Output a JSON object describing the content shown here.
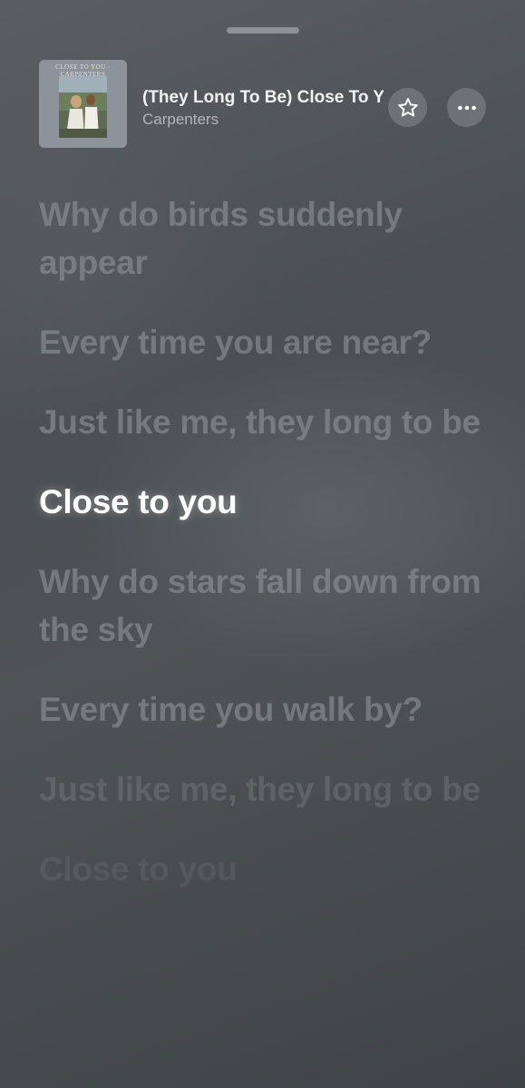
{
  "now_playing": {
    "title": "(They Long To Be) Close To You",
    "artist": "Carpenters",
    "artwork_text": "CLOSE TO YOU · CARPENTERS"
  },
  "controls": {
    "favorite_icon": "star-icon",
    "more_icon": "ellipsis-icon"
  },
  "lyrics": [
    "Why do birds suddenly appear",
    "Every time you are near?",
    "Just like me, they long to be",
    "Close to you",
    "Why do stars fall down from the sky",
    "Every time you walk by?",
    "Just like me, they long to be",
    "Close to you"
  ],
  "active_lyric": "Close to you",
  "colors": {
    "active": "#ffffff",
    "inactive": "#8c9094",
    "background": "#4a4f53"
  }
}
